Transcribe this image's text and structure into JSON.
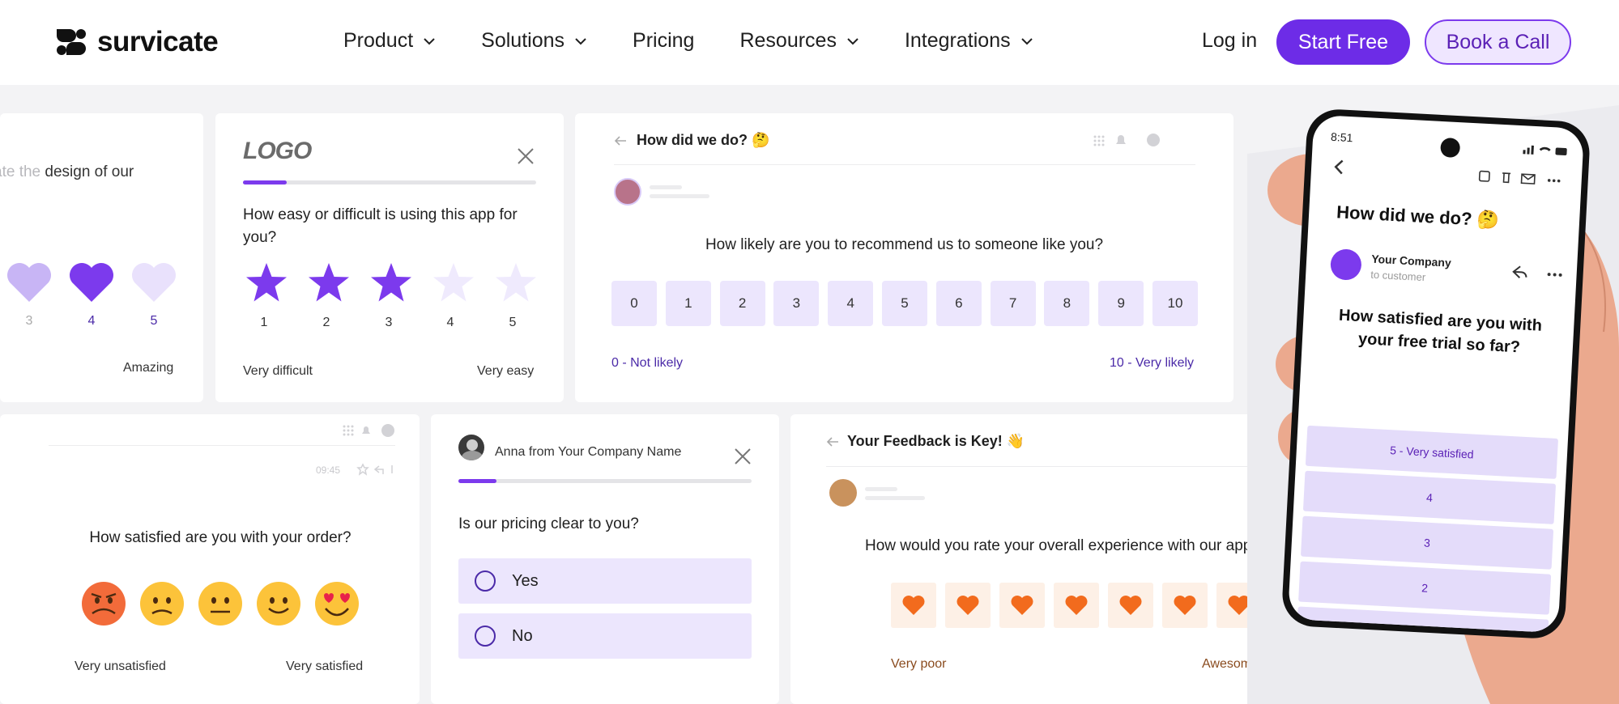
{
  "nav": {
    "brand": "survicate",
    "menu": [
      {
        "label": "Product",
        "dropdown": true
      },
      {
        "label": "Solutions",
        "dropdown": true
      },
      {
        "label": "Pricing",
        "dropdown": false
      },
      {
        "label": "Resources",
        "dropdown": true
      },
      {
        "label": "Integrations",
        "dropdown": true
      }
    ],
    "login": "Log in",
    "start_free": "Start Free",
    "book_call": "Book a Call"
  },
  "card_hearts": {
    "question_faded": "ate the ",
    "question": "design of our",
    "labels": [
      "3",
      "4",
      "5"
    ],
    "right_label": "Amazing"
  },
  "card_stars": {
    "logo": "LOGO",
    "question": "How easy or difficult is using this app for you?",
    "scale": [
      "1",
      "2",
      "3",
      "4",
      "5"
    ],
    "selected": 3,
    "left_label": "Very difficult",
    "right_label": "Very easy",
    "progress": 0.15
  },
  "card_nps": {
    "title": "How did we do? 🤔",
    "question": "How likely are you to recommend us to someone like you?",
    "scale": [
      "0",
      "1",
      "2",
      "3",
      "4",
      "5",
      "6",
      "7",
      "8",
      "9",
      "10"
    ],
    "left_label": "0 - Not likely",
    "right_label": "10 - Very likely"
  },
  "card_emoji": {
    "time": "09:45",
    "question": "How satisfied are you with your order?",
    "left_label": "Very unsatisfied",
    "right_label": "Very satisfied"
  },
  "card_pricing": {
    "sender": "Anna from Your Company Name",
    "question": "Is our pricing clear to you?",
    "options": [
      "Yes",
      "No"
    ],
    "progress": 0.13
  },
  "card_feedback": {
    "title": "Your Feedback is Key! 👋",
    "question": "How would you rate your overall experience with our app",
    "left_label": "Very poor",
    "right_label": "Awesome"
  },
  "phone": {
    "time": "8:51",
    "title": "How did we do? 🤔",
    "sender": "Your Company",
    "recipient": "to customer",
    "question": "How satisfied are you with your free trial so far?",
    "options": [
      "5 - Very satisfied",
      "4",
      "3",
      "2"
    ]
  },
  "colors": {
    "brand_purple": "#6d2ce7",
    "light_purple": "#ece6fd",
    "heart_orange": "#f26b1d"
  }
}
